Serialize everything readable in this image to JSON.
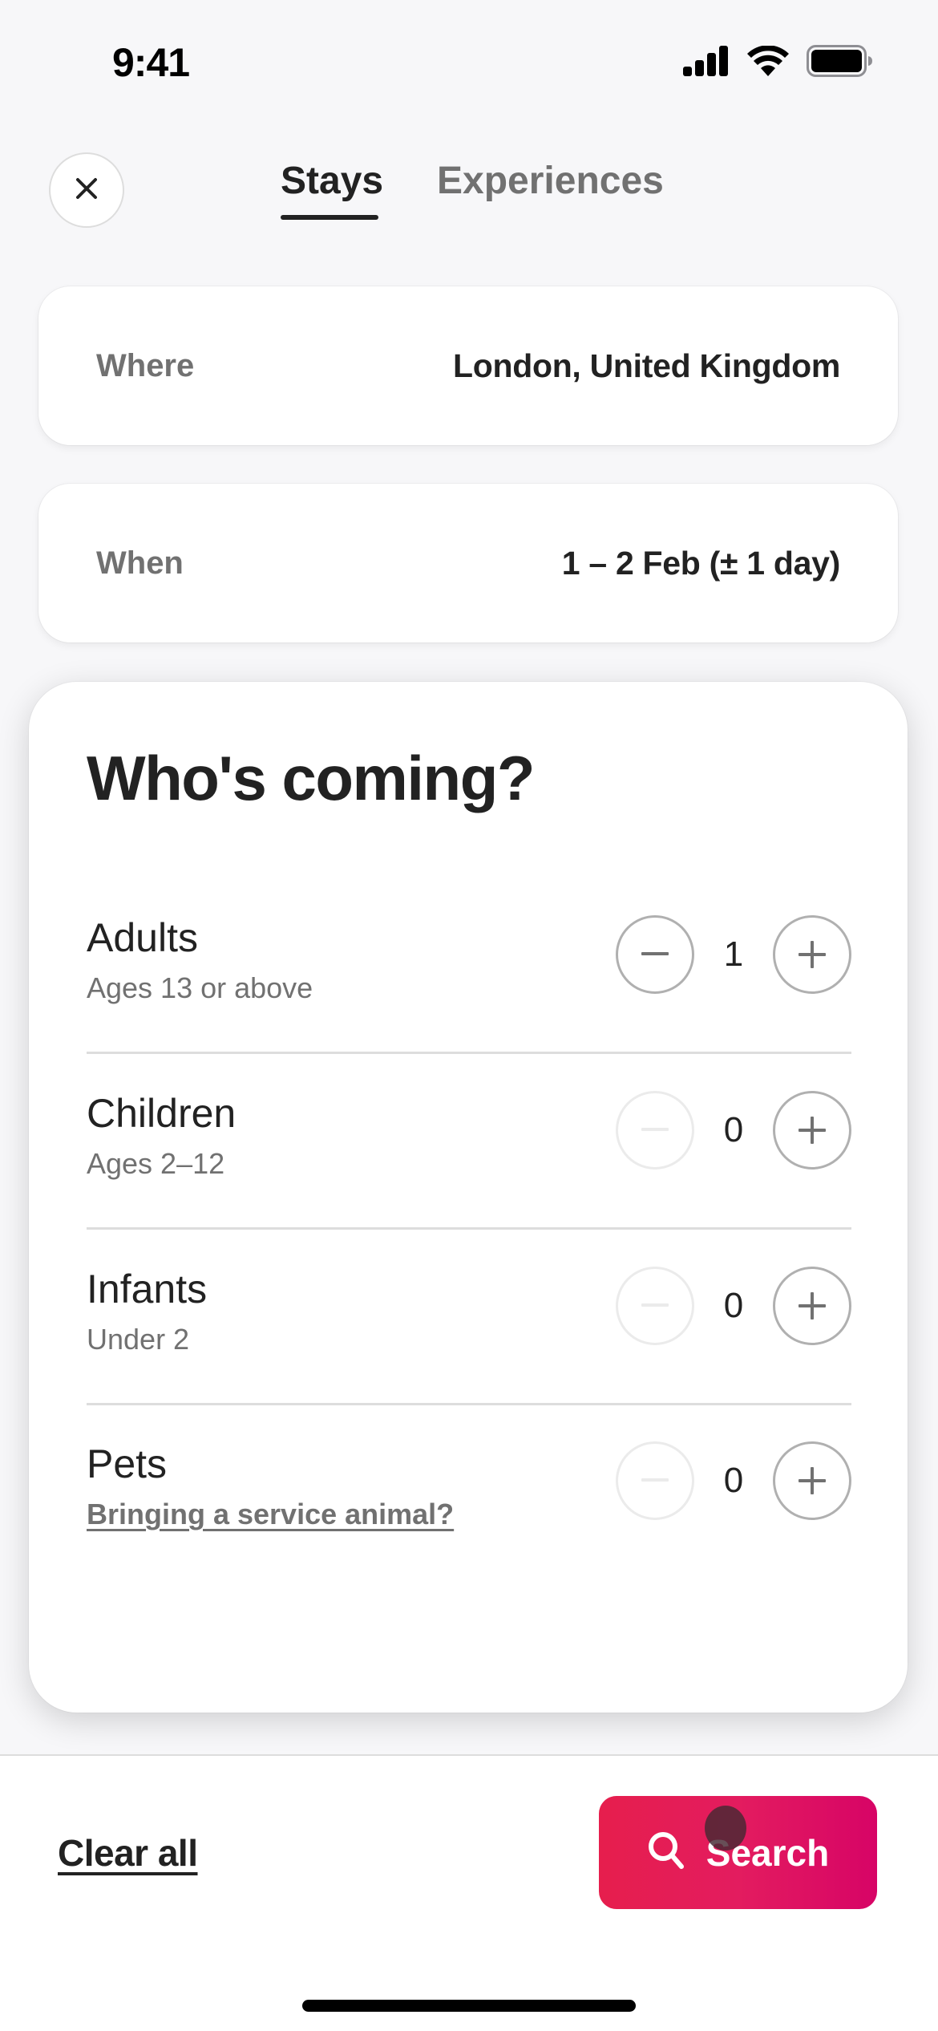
{
  "status_bar": {
    "time": "9:41",
    "icons": [
      "cellular-signal-icon",
      "wifi-icon",
      "battery-icon"
    ]
  },
  "header": {
    "close_icon": "close-icon",
    "tabs": [
      {
        "label": "Stays",
        "active": true
      },
      {
        "label": "Experiences",
        "active": false
      }
    ]
  },
  "where": {
    "label": "Where",
    "value": "London, United Kingdom"
  },
  "when": {
    "label": "When",
    "value": "1 – 2 Feb (± 1 day)"
  },
  "guests": {
    "title": "Who's coming?",
    "rows": [
      {
        "label": "Adults",
        "sub": "Ages 13 or above",
        "sub_is_link": false,
        "count": "1",
        "minus_enabled": true,
        "plus_enabled": true
      },
      {
        "label": "Children",
        "sub": "Ages 2–12",
        "sub_is_link": false,
        "count": "0",
        "minus_enabled": false,
        "plus_enabled": true
      },
      {
        "label": "Infants",
        "sub": "Under 2",
        "sub_is_link": false,
        "count": "0",
        "minus_enabled": false,
        "plus_enabled": true
      },
      {
        "label": "Pets",
        "sub": "Bringing a service animal?",
        "sub_is_link": true,
        "count": "0",
        "minus_enabled": false,
        "plus_enabled": true
      }
    ]
  },
  "footer": {
    "clear_label": "Clear all",
    "search_label": "Search",
    "search_icon": "search-icon"
  },
  "colors": {
    "brand_gradient_start": "#E61E4D",
    "brand_gradient_end": "#D70466",
    "text_primary": "#222222",
    "text_secondary": "#717171",
    "divider": "#DDDDDD",
    "background": "#F7F7F9"
  }
}
